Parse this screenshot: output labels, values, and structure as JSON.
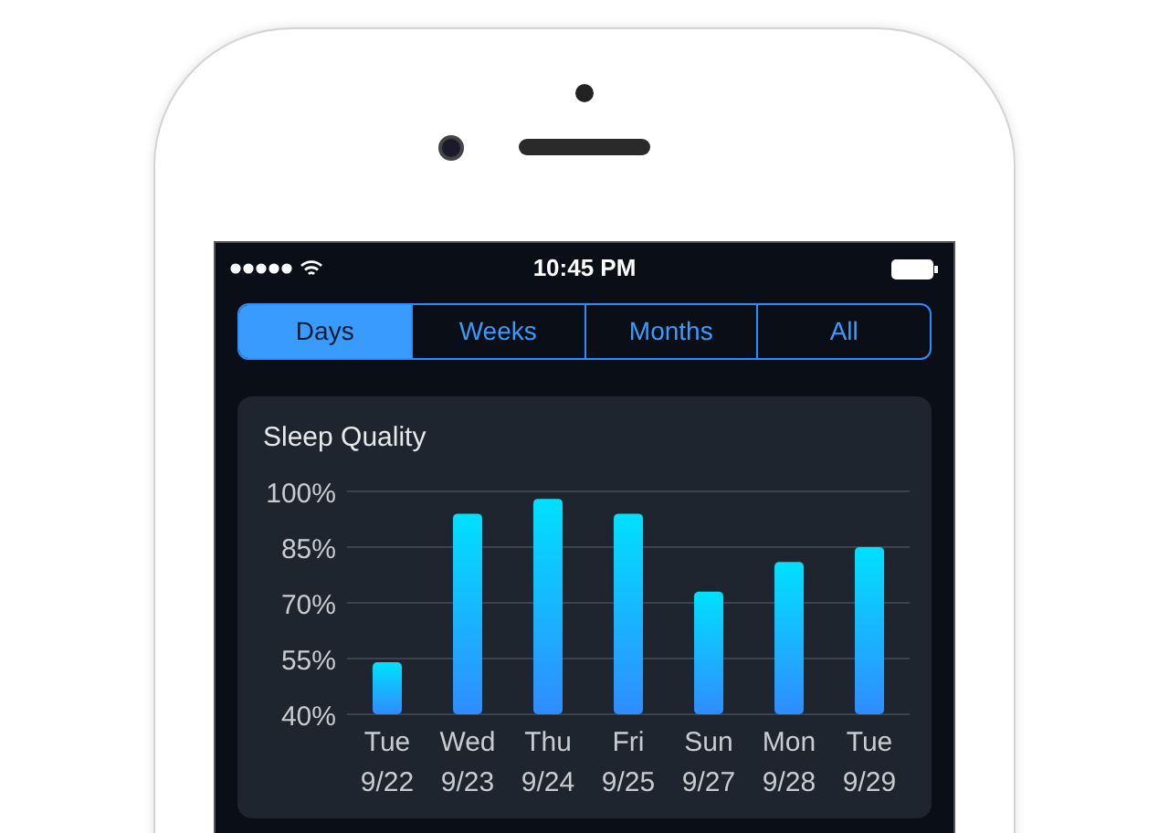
{
  "status_bar": {
    "time": "10:45 PM"
  },
  "tabs": [
    {
      "label": "Days",
      "selected": true
    },
    {
      "label": "Weeks",
      "selected": false
    },
    {
      "label": "Months",
      "selected": false
    },
    {
      "label": "All",
      "selected": false
    }
  ],
  "card": {
    "chart_data": {
      "type": "bar",
      "title": "Sleep Quality",
      "grid": true,
      "categories": [
        "Tue 9/22",
        "Wed 9/23",
        "Thu 9/24",
        "Fri 9/25",
        "Sun 9/27",
        "Mon 9/28",
        "Tue 9/29"
      ],
      "series": [
        {
          "color": "#00e0ff",
          "values": [
            54,
            94,
            98,
            94,
            73,
            81,
            85
          ]
        }
      ],
      "ylim": [
        40,
        100
      ],
      "yticks": [
        {
          "value": 40,
          "label": "40%"
        },
        {
          "value": 55,
          "label": "55%"
        },
        {
          "value": 70,
          "label": "70%"
        },
        {
          "value": 85,
          "label": "85%"
        },
        {
          "value": 100,
          "label": "100%"
        }
      ]
    }
  }
}
